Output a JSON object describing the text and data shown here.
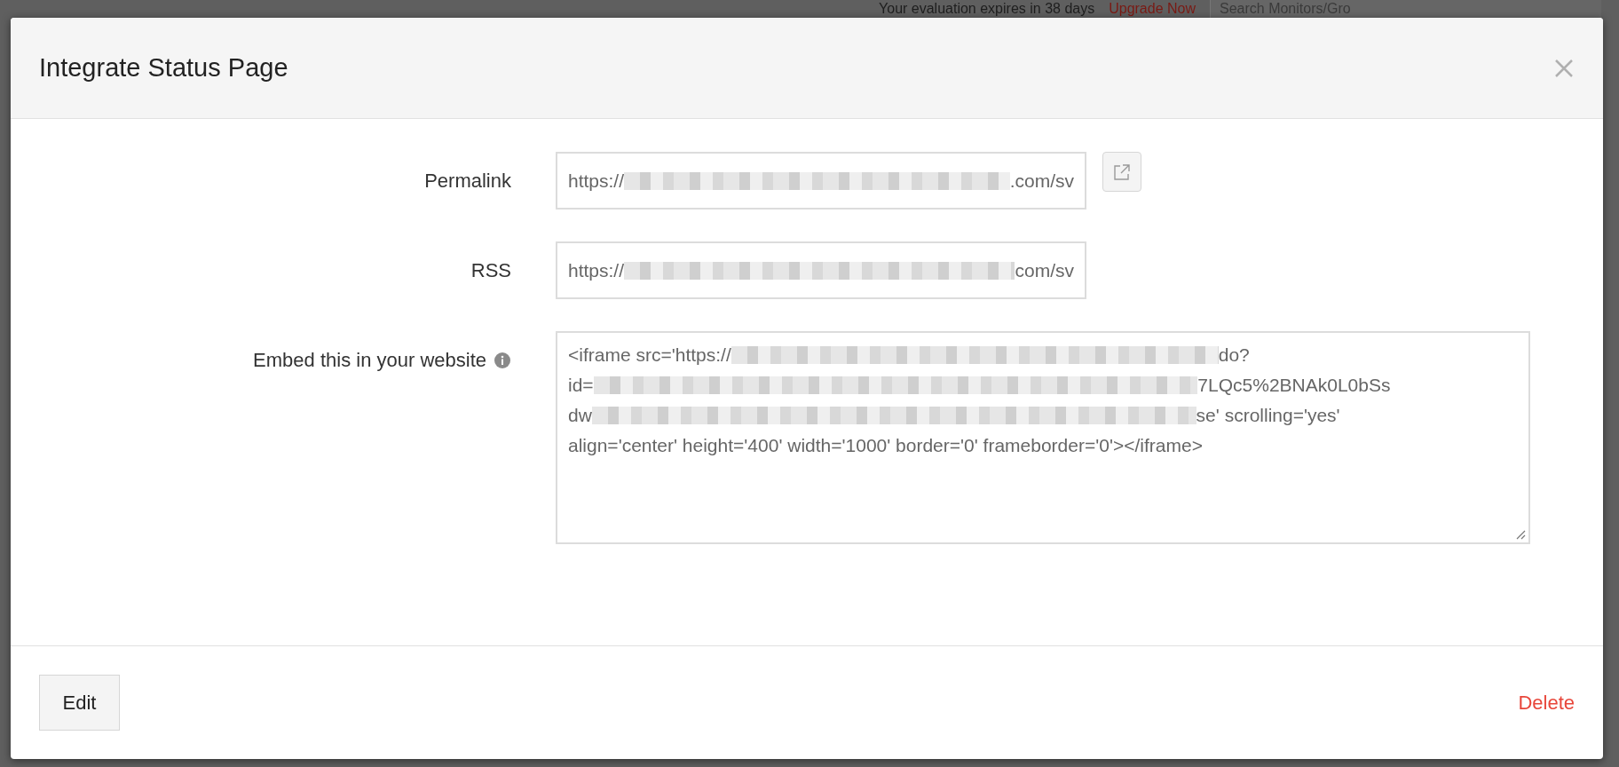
{
  "backdrop": {
    "notice": "Your evaluation expires in 38 days",
    "upgrade_link": "Upgrade Now",
    "search": {
      "placeholder": "Search Monitors/Gro"
    }
  },
  "dialog": {
    "title": "Integrate Status Page",
    "fields": [
      {
        "kind": "input",
        "label": "Permalink",
        "info": false,
        "open_button": true,
        "lines": [
          [
            {
              "kind": "text",
              "text": "https://"
            },
            {
              "kind": "redacted"
            },
            {
              "kind": "text",
              "text": ".com/sv"
            }
          ]
        ]
      },
      {
        "kind": "input",
        "label": "RSS",
        "info": false,
        "open_button": false,
        "lines": [
          [
            {
              "kind": "text",
              "text": "https://"
            },
            {
              "kind": "redacted"
            },
            {
              "kind": "text",
              "text": "com/sv"
            }
          ]
        ]
      },
      {
        "kind": "textarea",
        "label": "Embed this in your website",
        "info": true,
        "open_button": false,
        "lines": [
          [
            {
              "kind": "text",
              "text": "<iframe src='https://"
            },
            {
              "kind": "redacted"
            },
            {
              "kind": "text",
              "text": "do?"
            }
          ],
          [
            {
              "kind": "text",
              "text": "id="
            },
            {
              "kind": "redacted"
            },
            {
              "kind": "text",
              "text": "7LQc5%2BNAk0L0bSs"
            }
          ],
          [
            {
              "kind": "text",
              "text": "dw"
            },
            {
              "kind": "redacted"
            },
            {
              "kind": "text",
              "text": "se' scrolling='yes'"
            }
          ],
          [
            {
              "kind": "text",
              "text": "align='center' height='400' width='1000' border='0' frameborder='0'></iframe>"
            }
          ]
        ]
      }
    ],
    "edit_button": "Edit",
    "delete_link": "Delete"
  }
}
